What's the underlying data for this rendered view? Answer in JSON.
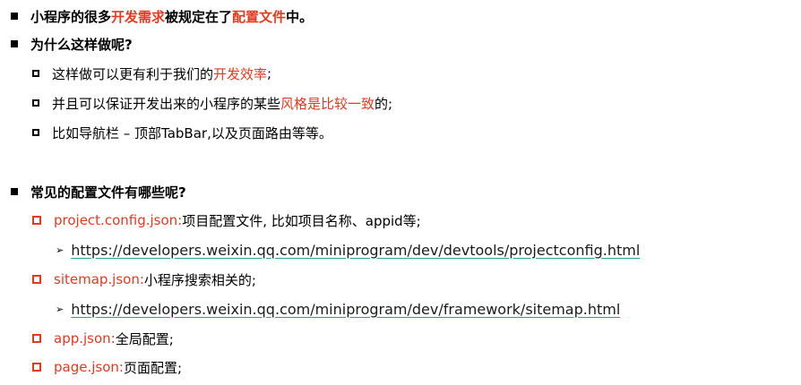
{
  "l1": {
    "pre": "小程序的很多",
    "red1": "开发需求",
    "mid": "被规定在了",
    "red2": "配置文件",
    "post": "中。"
  },
  "l2": {
    "text": "为什么这样做呢?"
  },
  "l3": {
    "pre": "这样做可以更有利于我们的",
    "red": "开发效率",
    "post": ";"
  },
  "l4": {
    "pre": "并且可以保证开发出来的小程序的某些",
    "red": "风格是比较一致",
    "post": "的;"
  },
  "l5": {
    "text": "比如导航栏 – 顶部TabBar,以及页面路由等等。"
  },
  "l6": {
    "text": "常见的配置文件有哪些呢?"
  },
  "l7": {
    "red": "project.config.json:",
    "rest": "项目配置文件, 比如项目名称、appid等;"
  },
  "l8": {
    "arrow": "➢",
    "link": "https://developers.weixin.qq.com/miniprogram/dev/devtools/projectconfig.html"
  },
  "l9": {
    "red": "sitemap.json:",
    "rest": "小程序搜索相关的;"
  },
  "l10": {
    "arrow": "➢",
    "link": "https://developers.weixin.qq.com/miniprogram/dev/framework/sitemap.html"
  },
  "l11": {
    "red": "app.json:",
    "rest": "全局配置;"
  },
  "l12": {
    "red": "page.json:",
    "rest": "页面配置;"
  }
}
